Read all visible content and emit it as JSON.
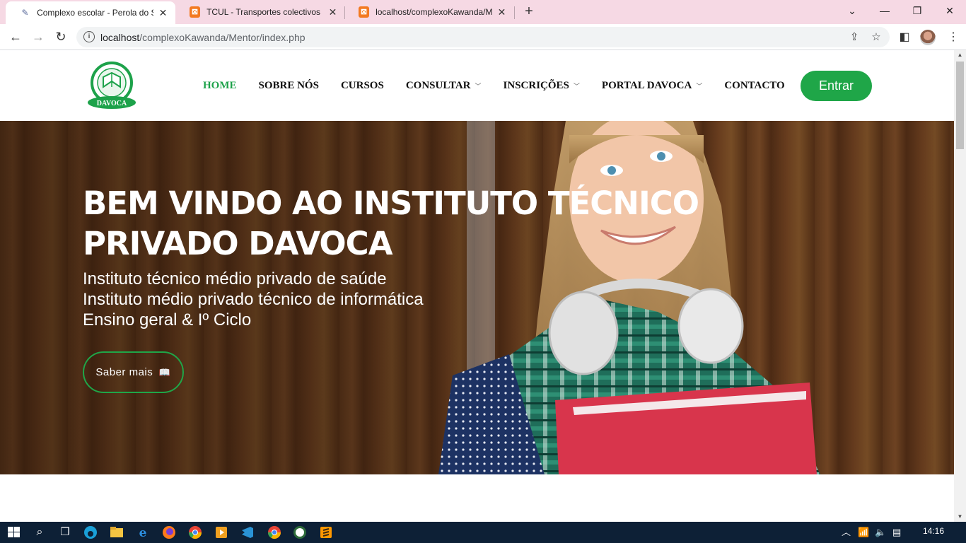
{
  "browser": {
    "tabs": [
      {
        "title": "Complexo escolar - Perola do Sal",
        "icon": "document-icon",
        "active": true
      },
      {
        "title": "TCUL - Transportes colectivos urb",
        "icon": "xampp-icon",
        "active": false
      },
      {
        "title": "localhost/complexoKawanda/Me",
        "icon": "xampp-icon",
        "active": false
      }
    ],
    "url_host": "localhost",
    "url_path": "/complexoKawanda/Mentor/index.php"
  },
  "site": {
    "logo_text": "DAVOCA",
    "nav": [
      {
        "label": "HOME",
        "active": true,
        "dropdown": false
      },
      {
        "label": "SOBRE NÓS",
        "active": false,
        "dropdown": false
      },
      {
        "label": "CURSOS",
        "active": false,
        "dropdown": false
      },
      {
        "label": "CONSULTAR",
        "active": false,
        "dropdown": true
      },
      {
        "label": "INSCRIÇÕES",
        "active": false,
        "dropdown": true
      },
      {
        "label": "PORTAL DAVOCA",
        "active": false,
        "dropdown": true
      },
      {
        "label": "CONTACTO",
        "active": false,
        "dropdown": false
      }
    ],
    "login_label": "Entrar",
    "accent": "#1fa648"
  },
  "hero": {
    "title_line1": "BEM VINDO AO INSTITUTO TÉCNICO",
    "title_line2": "PRIVADO DAVOCA",
    "subtitles": [
      "Instituto técnico médio privado de saúde",
      "Instituto médio privado técnico de informática",
      "Ensino geral & Iº Ciclo"
    ],
    "cta_label": "Saber mais"
  },
  "taskbar": {
    "clock": "14:16"
  }
}
